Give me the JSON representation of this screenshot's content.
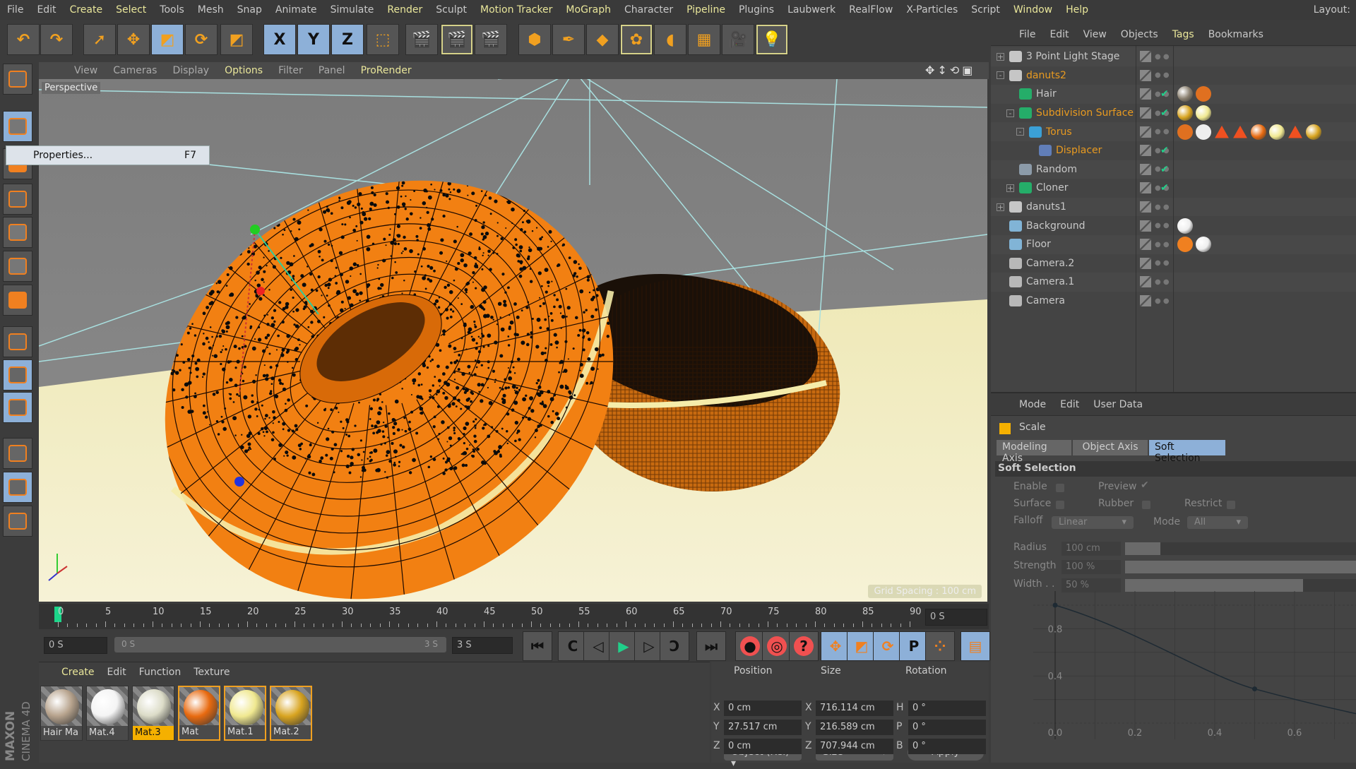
{
  "menubar": {
    "items": [
      {
        "label": "File",
        "hl": false
      },
      {
        "label": "Edit",
        "hl": false
      },
      {
        "label": "Create",
        "hl": true
      },
      {
        "label": "Select",
        "hl": true
      },
      {
        "label": "Tools",
        "hl": false
      },
      {
        "label": "Mesh",
        "hl": false
      },
      {
        "label": "Snap",
        "hl": false
      },
      {
        "label": "Animate",
        "hl": false
      },
      {
        "label": "Simulate",
        "hl": false
      },
      {
        "label": "Render",
        "hl": true
      },
      {
        "label": "Sculpt",
        "hl": false
      },
      {
        "label": "Motion Tracker",
        "hl": true
      },
      {
        "label": "MoGraph",
        "hl": true
      },
      {
        "label": "Character",
        "hl": false
      },
      {
        "label": "Pipeline",
        "hl": true
      },
      {
        "label": "Plugins",
        "hl": false
      },
      {
        "label": "Laubwerk",
        "hl": false
      },
      {
        "label": "RealFlow",
        "hl": false
      },
      {
        "label": "X-Particles",
        "hl": false
      },
      {
        "label": "Script",
        "hl": false
      },
      {
        "label": "Window",
        "hl": true
      },
      {
        "label": "Help",
        "hl": true
      }
    ],
    "layout_label": "Layout:"
  },
  "toolbar": {
    "buttons": [
      {
        "icon": "undo-icon",
        "glyph": "↶",
        "active": false
      },
      {
        "icon": "redo-icon",
        "glyph": "↷",
        "active": false
      },
      {
        "icon": "live-selection-icon",
        "glyph": "➚",
        "active": false
      },
      {
        "icon": "move-icon",
        "glyph": "✥",
        "active": false
      },
      {
        "icon": "scale-icon",
        "glyph": "◩",
        "active": true
      },
      {
        "icon": "rotate-icon",
        "glyph": "⟳",
        "active": false
      },
      {
        "icon": "recent-tool-icon",
        "glyph": "◩",
        "active": false
      },
      {
        "icon": "x-axis-lock-icon",
        "glyph": "X",
        "active": true
      },
      {
        "icon": "y-axis-lock-icon",
        "glyph": "Y",
        "active": true
      },
      {
        "icon": "z-axis-lock-icon",
        "glyph": "Z",
        "active": true
      },
      {
        "icon": "coordinate-system-icon",
        "glyph": "⬚",
        "active": false
      },
      {
        "icon": "render-view-icon",
        "glyph": "🎬",
        "active": false
      },
      {
        "icon": "render-picture-viewer-icon",
        "glyph": "🎬",
        "active": false,
        "framed": true
      },
      {
        "icon": "render-settings-icon",
        "glyph": "🎬",
        "active": false
      },
      {
        "icon": "cube-icon",
        "glyph": "⬢",
        "active": false
      },
      {
        "icon": "pen-spline-icon",
        "glyph": "✒",
        "active": false
      },
      {
        "icon": "subdivision-surface-icon",
        "glyph": "◆",
        "active": false
      },
      {
        "icon": "cloner-icon",
        "glyph": "✿",
        "active": false,
        "framed": true
      },
      {
        "icon": "deformer-icon",
        "glyph": "◖",
        "active": false
      },
      {
        "icon": "floor-icon",
        "glyph": "▦",
        "active": false
      },
      {
        "icon": "camera-icon",
        "glyph": "🎥",
        "active": false
      },
      {
        "icon": "light-icon",
        "glyph": "💡",
        "active": false,
        "framed": true
      }
    ]
  },
  "left_toolbar": {
    "buttons": [
      {
        "icon": "make-editable-icon",
        "active": false
      },
      {
        "icon": "model-mode-icon",
        "active": true
      },
      {
        "icon": "texture-mode-icon",
        "active": false
      },
      {
        "icon": "workplane-mode-icon",
        "active": false
      },
      {
        "icon": "points-mode-icon",
        "active": false
      },
      {
        "icon": "edges-mode-icon",
        "active": false
      },
      {
        "icon": "polygons-mode-icon",
        "active": false
      },
      {
        "icon": "axis-mode-icon",
        "active": false
      },
      {
        "icon": "tweak-mode-icon",
        "active": true
      },
      {
        "icon": "solo-mode-icon",
        "active": true
      },
      {
        "icon": "snap-magnet-icon",
        "active": false
      },
      {
        "icon": "lock-workplane-icon",
        "active": true
      },
      {
        "icon": "planar-workplane-icon",
        "active": false
      }
    ]
  },
  "context_menu": {
    "label": "Properties...",
    "shortcut": "F7"
  },
  "viewport": {
    "menu": [
      {
        "label": "View",
        "hl": false
      },
      {
        "label": "Cameras",
        "hl": false
      },
      {
        "label": "Display",
        "hl": false
      },
      {
        "label": "Options",
        "hl": true
      },
      {
        "label": "Filter",
        "hl": false
      },
      {
        "label": "Panel",
        "hl": false
      },
      {
        "label": "ProRender",
        "hl": true
      }
    ],
    "camera_label": "Perspective",
    "grid_spacing": "Grid Spacing : 100 cm",
    "colors": {
      "donut": "#f07a10",
      "floor": "#f0ecc4",
      "wire": "#a8e0e0"
    }
  },
  "timeline": {
    "ticks": [
      0,
      5,
      10,
      15,
      20,
      25,
      30,
      35,
      40,
      45,
      50,
      55,
      60,
      65,
      70,
      75,
      80,
      85,
      90
    ],
    "current_frame": 0,
    "current_time": "0 S",
    "start": "0 S",
    "range_start": "0 S",
    "range_end": "3 S",
    "end": "3 S"
  },
  "playback": {
    "buttons": [
      {
        "icon": "go-to-start-icon",
        "glyph": "⏮"
      },
      {
        "icon": "previous-key-icon",
        "glyph": "C"
      },
      {
        "icon": "previous-frame-icon",
        "glyph": "◁"
      },
      {
        "icon": "play-icon",
        "glyph": "▶"
      },
      {
        "icon": "next-frame-icon",
        "glyph": "▷"
      },
      {
        "icon": "next-key-icon",
        "glyph": "Ↄ"
      },
      {
        "icon": "go-to-end-icon",
        "glyph": "⏭"
      }
    ],
    "record": [
      {
        "icon": "record-keys-icon",
        "glyph": "●"
      },
      {
        "icon": "autokeying-icon",
        "glyph": "◎"
      },
      {
        "icon": "keyframe-selection-icon",
        "glyph": "?"
      }
    ],
    "key_filters": [
      {
        "icon": "key-position-icon",
        "glyph": "✥"
      },
      {
        "icon": "key-scale-icon",
        "glyph": "◩"
      },
      {
        "icon": "key-rotation-icon",
        "glyph": "⟳"
      },
      {
        "icon": "key-parameter-icon",
        "glyph": "P"
      },
      {
        "icon": "key-point-level-icon",
        "glyph": "⁘"
      }
    ],
    "timeline_icon": "timeline-window-icon"
  },
  "materials": {
    "menu": [
      {
        "label": "Create",
        "hl": true
      },
      {
        "label": "Edit",
        "hl": false
      },
      {
        "label": "Function",
        "hl": false
      },
      {
        "label": "Texture",
        "hl": false
      }
    ],
    "items": [
      {
        "name": "Hair Ma",
        "color": "#b8a48e",
        "sel": false,
        "cur": false
      },
      {
        "name": "Mat.4",
        "color": "#f4f4f4",
        "sel": false,
        "cur": false
      },
      {
        "name": "Mat.3",
        "color": "#dcdcc8",
        "sel": false,
        "cur": true
      },
      {
        "name": "Mat",
        "color": "#e86a10",
        "sel": true,
        "cur": false
      },
      {
        "name": "Mat.1",
        "color": "#f0e890",
        "sel": true,
        "cur": false
      },
      {
        "name": "Mat.2",
        "color": "#d8a420",
        "sel": true,
        "cur": false
      }
    ]
  },
  "brand": {
    "logo": "MAXON CINEMA 4D"
  },
  "coordinates": {
    "headers": {
      "position": "Position",
      "size": "Size",
      "rotation": "Rotation"
    },
    "rows": [
      {
        "pl": "X",
        "pv": "0 cm",
        "sl": "X",
        "sv": "716.114 cm",
        "rl": "H",
        "rv": "0 °"
      },
      {
        "pl": "Y",
        "pv": "27.517 cm",
        "sl": "Y",
        "sv": "216.589 cm",
        "rl": "P",
        "rv": "0 °"
      },
      {
        "pl": "Z",
        "pv": "0 cm",
        "sl": "Z",
        "sv": "707.944 cm",
        "rl": "B",
        "rv": "0 °"
      }
    ],
    "mode": "Object (Rel)",
    "size_mode": "Size",
    "apply": "Apply"
  },
  "objects": {
    "menu": [
      {
        "label": "File",
        "hl": false
      },
      {
        "label": "Edit",
        "hl": false
      },
      {
        "label": "View",
        "hl": false
      },
      {
        "label": "Objects",
        "hl": false
      },
      {
        "label": "Tags",
        "hl": true
      },
      {
        "label": "Bookmarks",
        "hl": false
      }
    ],
    "rows": [
      {
        "name": "3 Point Light Stage",
        "depth": 0,
        "expander": "+",
        "icon": "null-icon",
        "orange": false,
        "check": false,
        "tags": []
      },
      {
        "name": "danuts2",
        "depth": 0,
        "expander": "-",
        "icon": "null-icon",
        "orange": true,
        "check": false,
        "tags": []
      },
      {
        "name": "Hair",
        "depth": 1,
        "expander": "",
        "icon": "hair-icon",
        "orange": false,
        "check": true,
        "tags": [
          "hair-material-tag",
          "vertex-tag"
        ]
      },
      {
        "name": "Subdivision Surface",
        "depth": 1,
        "expander": "-",
        "icon": "subdivision-surface-icon",
        "orange": true,
        "check": true,
        "tags": [
          "material-tag-gold",
          "material-tag-cream"
        ]
      },
      {
        "name": "Torus",
        "depth": 2,
        "expander": "-",
        "icon": "torus-icon",
        "orange": true,
        "check": false,
        "tags": [
          "vertex-tag",
          "uvw-tag",
          "selection-tag",
          "selection-tag",
          "material-tag-orange",
          "material-tag-cream",
          "selection-tag-active",
          "material-tag-gold"
        ]
      },
      {
        "name": "Displacer",
        "depth": 3,
        "expander": "",
        "icon": "displacer-icon",
        "orange": true,
        "check": true,
        "tags": []
      },
      {
        "name": "Random",
        "depth": 1,
        "expander": "",
        "icon": "random-effector-icon",
        "orange": false,
        "check": true,
        "tags": []
      },
      {
        "name": "Cloner",
        "depth": 1,
        "expander": "+",
        "icon": "cloner-icon",
        "orange": false,
        "check": true,
        "tags": []
      },
      {
        "name": "danuts1",
        "depth": 0,
        "expander": "+",
        "icon": "null-icon",
        "orange": false,
        "check": false,
        "tags": []
      },
      {
        "name": "Background",
        "depth": 0,
        "expander": "",
        "icon": "background-icon",
        "orange": false,
        "check": false,
        "tags": [
          "material-tag-white"
        ]
      },
      {
        "name": "Floor",
        "depth": 0,
        "expander": "",
        "icon": "floor-icon",
        "orange": false,
        "check": false,
        "tags": [
          "compositing-tag",
          "material-tag-white"
        ]
      },
      {
        "name": "Camera.2",
        "depth": 0,
        "expander": "",
        "icon": "camera-icon",
        "orange": false,
        "check": false,
        "tags": []
      },
      {
        "name": "Camera.1",
        "depth": 0,
        "expander": "",
        "icon": "camera-icon",
        "orange": false,
        "check": false,
        "tags": []
      },
      {
        "name": "Camera",
        "depth": 0,
        "expander": "",
        "icon": "camera-icon",
        "orange": false,
        "check": false,
        "tags": []
      }
    ]
  },
  "attributes": {
    "menu": [
      "Mode",
      "Edit",
      "User Data"
    ],
    "tool": "Scale",
    "tabs": [
      {
        "label": "Modeling Axis",
        "active": false
      },
      {
        "label": "Object Axis",
        "active": false
      },
      {
        "label": "Soft Selection",
        "active": true
      }
    ],
    "section": "Soft Selection",
    "enable": {
      "label": "Enable",
      "checked": false
    },
    "preview": {
      "label": "Preview",
      "checked": true
    },
    "surface": {
      "label": "Surface",
      "checked": false
    },
    "rubber": {
      "label": "Rubber",
      "checked": false
    },
    "restrict": {
      "label": "Restrict",
      "checked": false
    },
    "falloff": {
      "label": "Falloff",
      "value": "Linear"
    },
    "mode": {
      "label": "Mode",
      "value": "All"
    },
    "radius": {
      "label": "Radius",
      "value": "100 cm",
      "fill": 0.1
    },
    "strength": {
      "label": "Strength",
      "value": "100 %",
      "fill": 1.0
    },
    "width": {
      "label": "Width . .",
      "value": "50 %",
      "fill": 0.5
    },
    "curve": {
      "x_ticks": [
        "0.0",
        "0.2",
        "0.4",
        "0.6"
      ],
      "y_ticks": [
        "0.8",
        "0.4"
      ],
      "points": [
        [
          0,
          1
        ],
        [
          0.5,
          0.29
        ]
      ]
    }
  }
}
